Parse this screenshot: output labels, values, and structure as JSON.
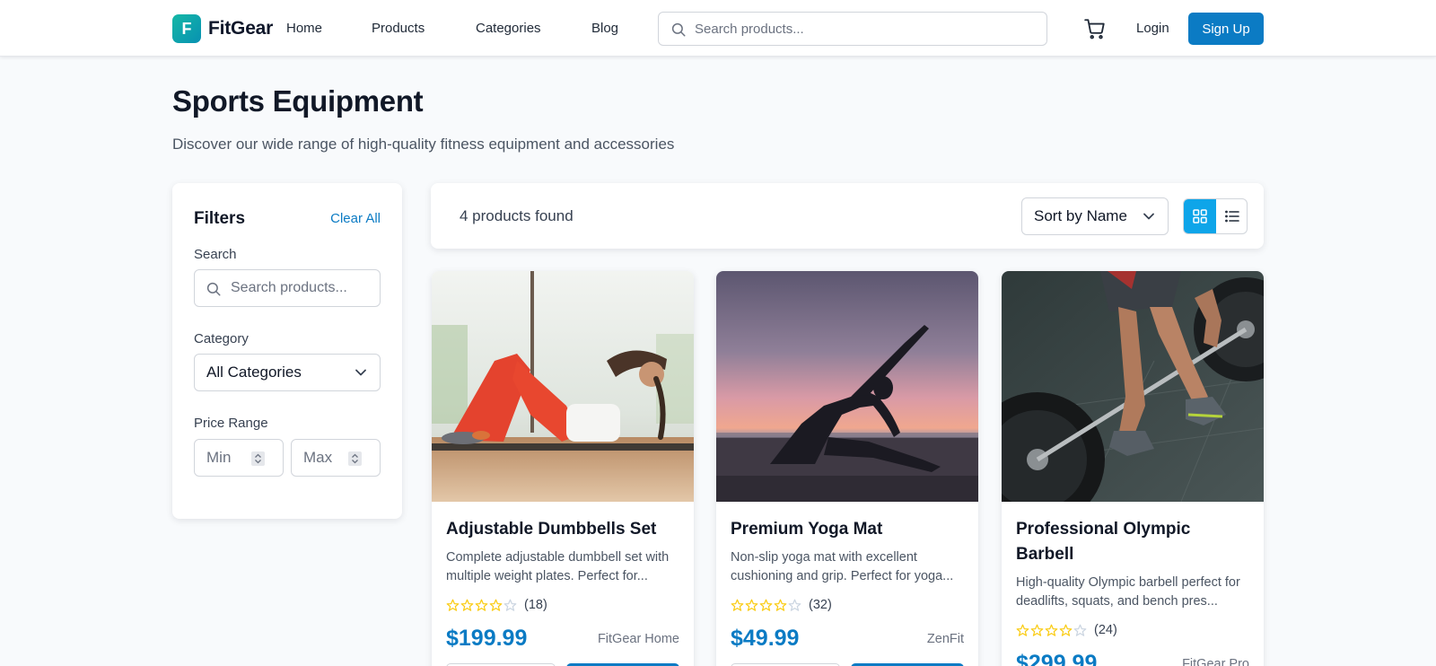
{
  "nav": {
    "logo_letter": "F",
    "brand": "FitGear",
    "links": [
      "Home",
      "Products",
      "Categories",
      "Blog"
    ],
    "search_placeholder": "Search products...",
    "login": "Login",
    "signup": "Sign Up"
  },
  "header": {
    "title": "Sports Equipment",
    "subtitle": "Discover our wide range of high-quality fitness equipment and accessories"
  },
  "filters": {
    "title": "Filters",
    "clear_all": "Clear All",
    "search_label": "Search",
    "search_placeholder": "Search products...",
    "category_label": "Category",
    "category_value": "All Categories",
    "price_label": "Price Range",
    "min_placeholder": "Min",
    "max_placeholder": "Max"
  },
  "results": {
    "count_text": "4 products found",
    "sort_value": "Sort by Name",
    "view_mode": "grid"
  },
  "products": [
    {
      "title": "Adjustable Dumbbells Set",
      "description": "Complete adjustable dumbbell set with multiple weight plates. Perfect for...",
      "rating_count": "(18)",
      "price": "$199.99",
      "brand": "FitGear Home"
    },
    {
      "title": "Premium Yoga Mat",
      "description": "Non-slip yoga mat with excellent cushioning and grip. Perfect for yoga...",
      "rating_count": "(32)",
      "price": "$49.99",
      "brand": "ZenFit"
    },
    {
      "title": "Professional Olympic Barbell",
      "description": "High-quality Olympic barbell perfect for deadlifts, squats, and bench pres...",
      "rating_count": "(24)",
      "price": "$299.99",
      "brand": "FitGear Pro"
    }
  ],
  "colors": {
    "accent": "#0b7bc4",
    "accent_light": "#0ea5e9",
    "logo_gradient_start": "#14b8a6",
    "star": "#facc15",
    "page_bg": "#f8fafc"
  },
  "icons": {
    "search": "search-icon",
    "cart": "cart-icon",
    "chevron": "chevron-down-icon",
    "grid": "grid-view-icon",
    "list": "list-view-icon",
    "star": "star-outline-icon"
  }
}
